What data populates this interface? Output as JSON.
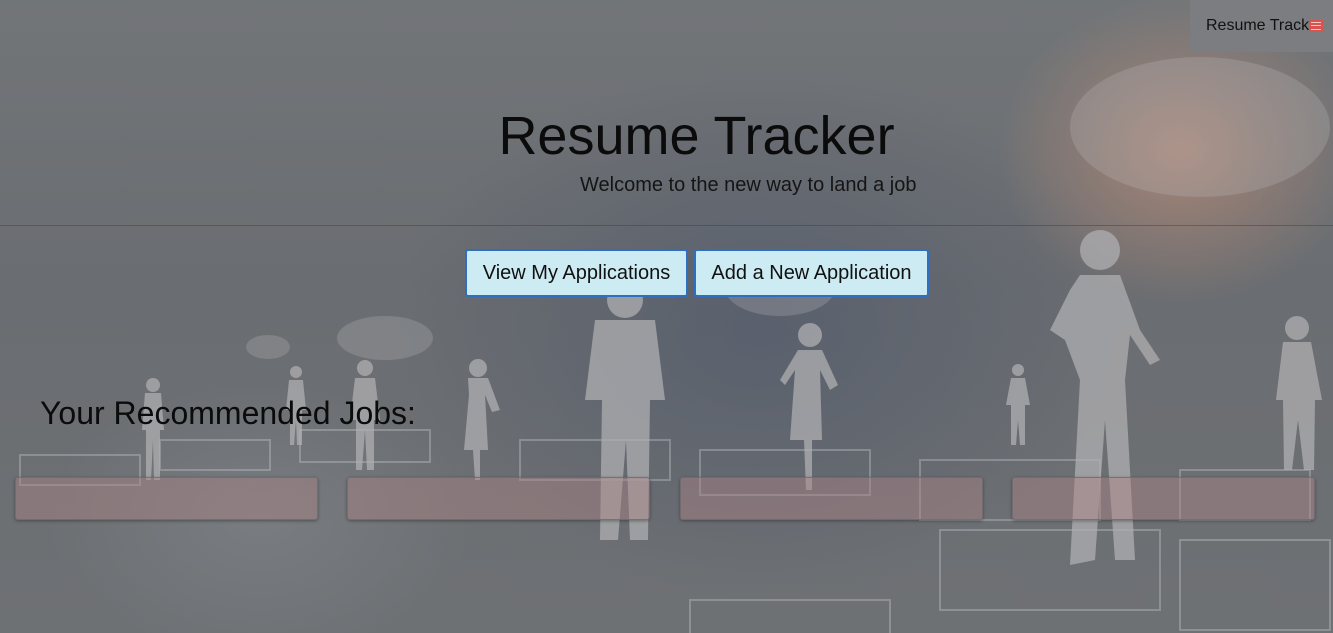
{
  "navbar": {
    "brand": "Resume Tracker",
    "toggle_icon": "hamburger-menu-icon",
    "toggle_color": "#d9534f"
  },
  "header": {
    "title": "Resume Tracker",
    "subtitle": "Welcome to the new way to land a job"
  },
  "actions": {
    "view_label": "View My Applications",
    "add_label": "Add a New Application"
  },
  "recommended": {
    "heading": "Your Recommended Jobs:",
    "cards": [
      {
        "label": ""
      },
      {
        "label": ""
      },
      {
        "label": ""
      },
      {
        "label": ""
      }
    ]
  },
  "colors": {
    "button_bg": "#cdebf2",
    "button_border": "#2f6fbf",
    "card_bg": "#b08486"
  }
}
